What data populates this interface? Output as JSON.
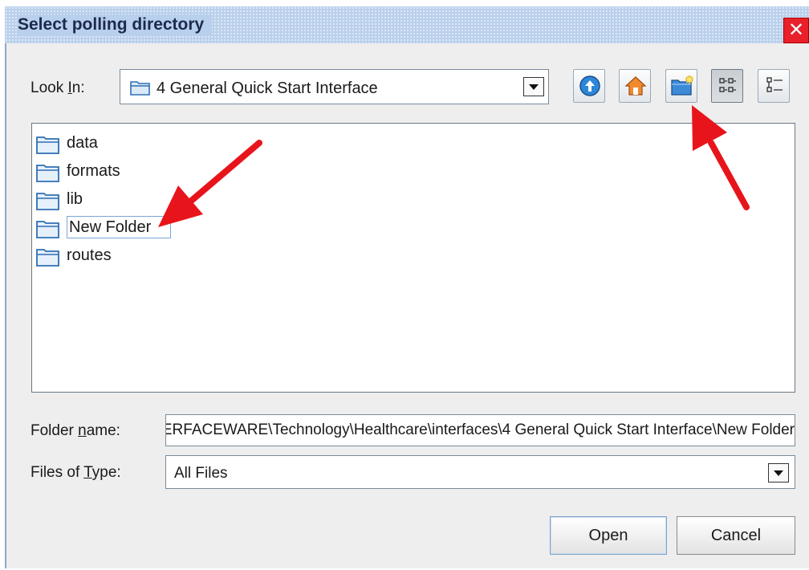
{
  "dialog": {
    "title": "Select polling directory",
    "close_glyph": "✕"
  },
  "lookin": {
    "label_prefix": "Look ",
    "label_mnemonic": "I",
    "label_suffix": "n:",
    "value": "4 General Quick Start Interface"
  },
  "toolbar": {
    "up_icon": "up-one-level-icon",
    "home_icon": "home-icon",
    "new_folder_icon": "new-folder-icon",
    "list_icon": "list-view-icon",
    "details_icon": "details-view-icon"
  },
  "files": {
    "items": [
      {
        "name": "data"
      },
      {
        "name": "formats"
      },
      {
        "name": "lib"
      },
      {
        "name": "New Folder",
        "editing": true
      },
      {
        "name": "routes"
      }
    ]
  },
  "folder_name": {
    "label_prefix": "Folder ",
    "label_mnemonic": "n",
    "label_suffix": "ame:",
    "value": "C:\\Program Files\\iNTERFACEWARE\\Technology\\Healthcare\\interfaces\\4 General Quick Start Interface\\New Folder"
  },
  "files_of_type": {
    "label_prefix": "Files of ",
    "label_mnemonic": "T",
    "label_suffix": "ype:",
    "value": "All Files"
  },
  "buttons": {
    "open": "Open",
    "cancel": "Cancel"
  },
  "annotation": {
    "arrow_color": "#e8141c"
  }
}
